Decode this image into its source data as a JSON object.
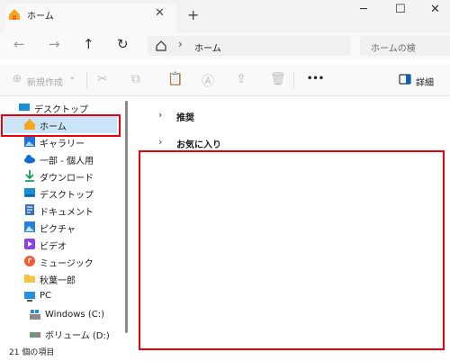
{
  "window": {
    "tab_title": "ホーム",
    "close_tab": "✕",
    "new_tab": "+",
    "minimize": "─",
    "maximize": "☐",
    "close": "✕"
  },
  "nav": {
    "back": "←",
    "forward": "→",
    "up": "↑",
    "refresh": "↻",
    "breadcrumb_sep": "›",
    "location": "ホーム",
    "search_placeholder": "ホームの検"
  },
  "commands": {
    "new_label": "新規作成",
    "new_chevron": "⌄",
    "more": "•••",
    "details_label": "詳細"
  },
  "sidebar": {
    "items": [
      {
        "label": "デスクトップ",
        "icon": "desktop-folder-icon"
      },
      {
        "label": "ホーム",
        "icon": "home-icon"
      },
      {
        "label": "ギャラリー",
        "icon": "gallery-icon"
      },
      {
        "label": "一部 - 個人用",
        "icon": "onedrive-icon"
      },
      {
        "label": "ダウンロード",
        "icon": "download-icon"
      },
      {
        "label": "デスクトップ",
        "icon": "desktop-icon"
      },
      {
        "label": "ドキュメント",
        "icon": "documents-icon"
      },
      {
        "label": "ピクチャ",
        "icon": "pictures-icon"
      },
      {
        "label": "ビデオ",
        "icon": "videos-icon"
      },
      {
        "label": "ミュージック",
        "icon": "music-icon"
      },
      {
        "label": "秋葉一郎",
        "icon": "user-folder-icon"
      },
      {
        "label": "PC",
        "icon": "pc-icon"
      },
      {
        "label": "Windows (C:)",
        "icon": "drive-c-icon"
      },
      {
        "label": "ボリューム (D:)",
        "icon": "drive-d-icon"
      }
    ]
  },
  "main": {
    "sections": [
      {
        "label": "推奨",
        "chevron": "›"
      },
      {
        "label": "お気に入り",
        "chevron": "›"
      }
    ]
  },
  "status": {
    "item_count": "21 個の項目"
  },
  "colors": {
    "highlight_red": "#e8000b",
    "accent_blue": "#0067c0"
  }
}
